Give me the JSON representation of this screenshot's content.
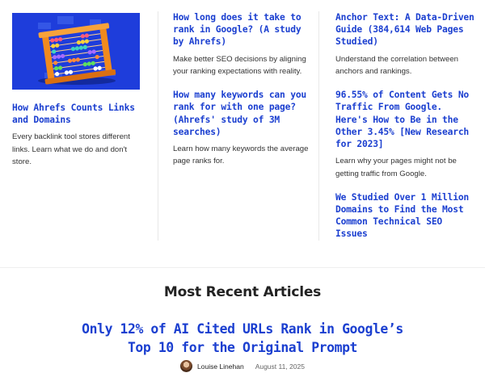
{
  "columns": [
    {
      "articles": [
        {
          "title": "How Ahrefs Counts Links and Domains",
          "description": "Every backlink tool stores different links. Learn what we do and don't store."
        }
      ]
    },
    {
      "articles": [
        {
          "title": "How long does it take to rank in Google? (A study by Ahrefs)",
          "description": "Make better SEO decisions by aligning your ranking expectations with reality."
        },
        {
          "title": "How many keywords can you rank for with one page? (Ahrefs' study of 3M searches)",
          "description": "Learn how many keywords the average page ranks for."
        }
      ]
    },
    {
      "articles": [
        {
          "title": "Anchor Text: A Data-Driven Guide (384,614 Web Pages Studied)",
          "description": "Understand the correlation between anchors and rankings."
        },
        {
          "title": "96.55% of Content Gets No Traffic From Google. Here's How to Be in the Other 3.45% [New Research for 2023]",
          "description": "Learn why your pages might not be getting traffic from Google."
        },
        {
          "title": "We Studied Over 1 Million Domains to Find the Most Common Technical SEO Issues",
          "description": ""
        }
      ]
    }
  ],
  "thumbnail": {
    "icon": "abacus-illustration",
    "background": "#1e3ddb"
  },
  "recent": {
    "heading": "Most Recent Articles",
    "featured": {
      "title": "Only 12% of AI Cited URLs Rank in Google’s Top 10 for the Original Prompt",
      "author": "Louise Linehan",
      "date": "August 11, 2025"
    }
  },
  "colors": {
    "link": "#1b3fd0",
    "text": "#333333",
    "divider": "#e8e8e8"
  }
}
